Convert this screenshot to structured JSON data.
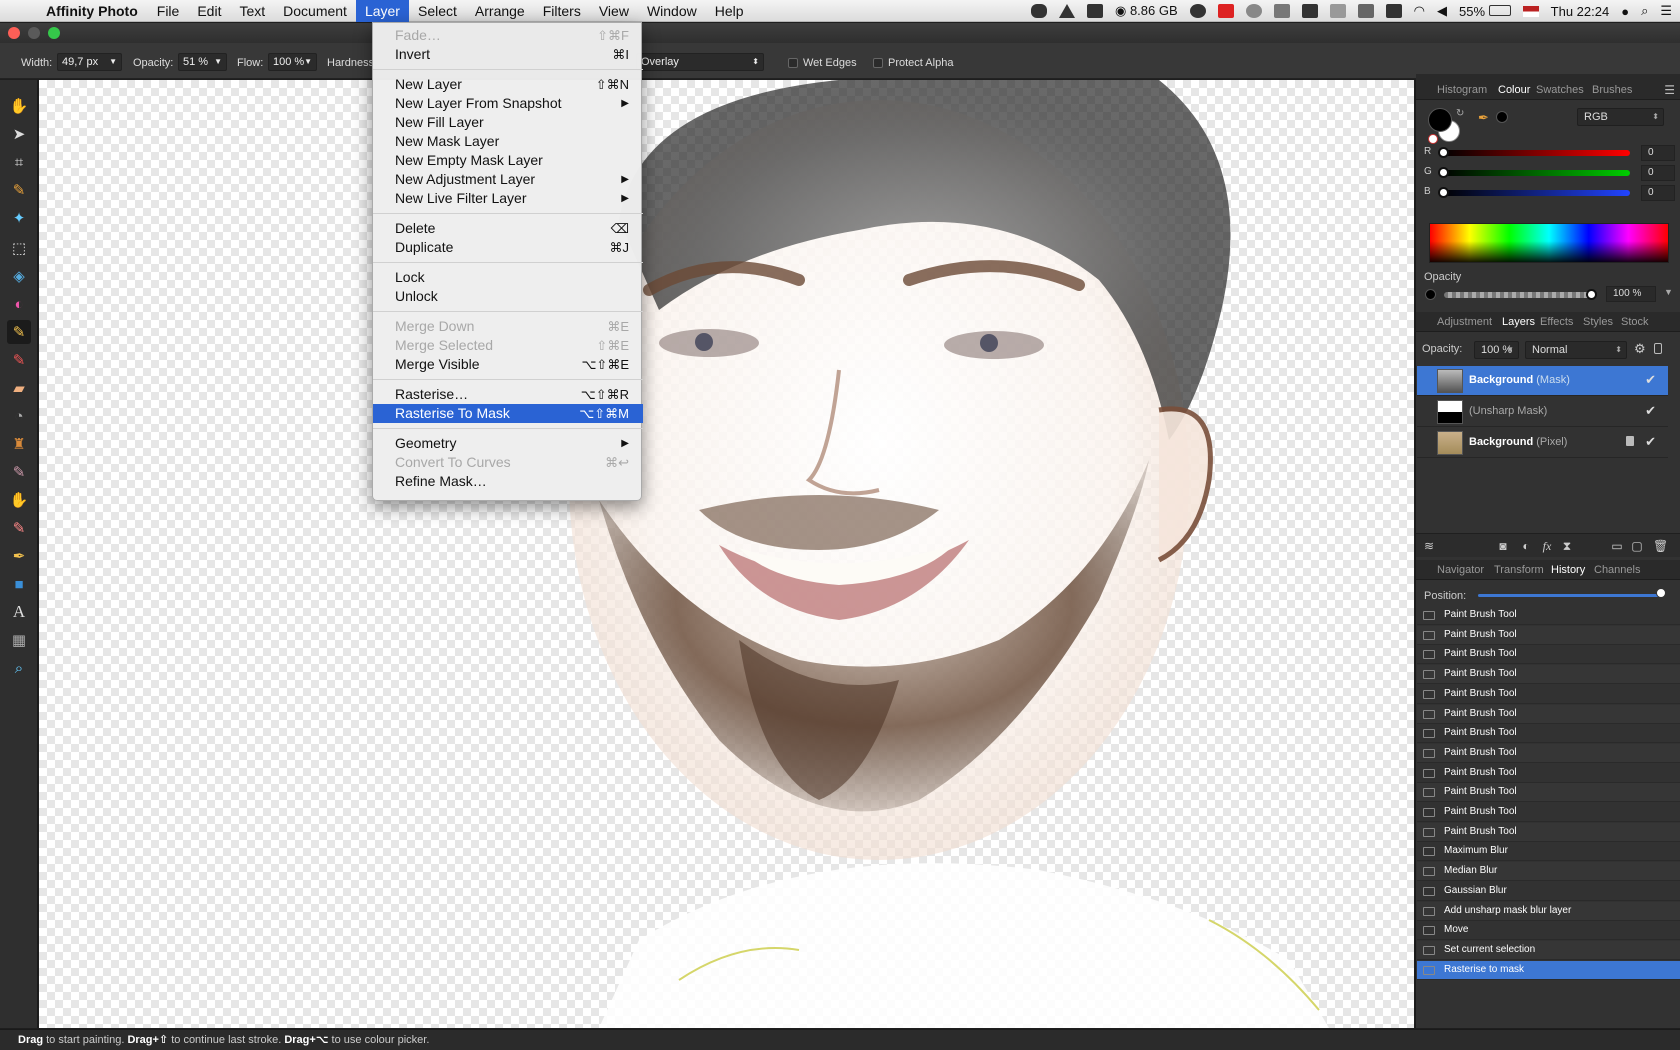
{
  "menubar": {
    "app_name": "Affinity Photo",
    "items": [
      "File",
      "Edit",
      "Text",
      "Document",
      "Layer",
      "Select",
      "Arrange",
      "Filters",
      "View",
      "Window",
      "Help"
    ],
    "memory": "8.86 GB",
    "battery": "55%",
    "clock": "Thu 22:24"
  },
  "context_toolbar": {
    "width_label": "Width:",
    "width_value": "49,7 px",
    "opacity_label": "Opacity:",
    "opacity_value": "51 %",
    "flow_label": "Flow:",
    "flow_value": "100 %",
    "hardness_label": "Hardness",
    "blend_mode": "Overlay",
    "wet_edges": "Wet Edges",
    "protect_alpha": "Protect Alpha"
  },
  "layer_menu": {
    "items": [
      {
        "label": "Fade…",
        "shortcut": "⇧⌘F",
        "disabled": true
      },
      {
        "label": "Invert",
        "shortcut": "⌘I"
      },
      {
        "sep": true
      },
      {
        "label": "New Layer",
        "shortcut": "⇧⌘N"
      },
      {
        "label": "New Layer From Snapshot",
        "submenu": true
      },
      {
        "label": "New Fill Layer"
      },
      {
        "label": "New Mask Layer"
      },
      {
        "label": "New Empty Mask Layer"
      },
      {
        "label": "New Adjustment Layer",
        "submenu": true
      },
      {
        "label": "New Live Filter Layer",
        "submenu": true
      },
      {
        "sep": true
      },
      {
        "label": "Delete",
        "shortcut": "⌫"
      },
      {
        "label": "Duplicate",
        "shortcut": "⌘J"
      },
      {
        "sep": true
      },
      {
        "label": "Lock"
      },
      {
        "label": "Unlock"
      },
      {
        "sep": true
      },
      {
        "label": "Merge Down",
        "shortcut": "⌘E",
        "disabled": true
      },
      {
        "label": "Merge Selected",
        "shortcut": "⇧⌘E",
        "disabled": true
      },
      {
        "label": "Merge Visible",
        "shortcut": "⌥⇧⌘E"
      },
      {
        "sep": true
      },
      {
        "label": "Rasterise…",
        "shortcut": "⌥⇧⌘R"
      },
      {
        "label": "Rasterise To Mask",
        "shortcut": "⌥⇧⌘M",
        "highlight": true
      },
      {
        "sep": true
      },
      {
        "label": "Geometry",
        "submenu": true
      },
      {
        "label": "Convert To Curves",
        "shortcut": "⌘↩",
        "disabled": true
      },
      {
        "label": "Refine Mask…"
      }
    ]
  },
  "colour_panel": {
    "tabs": [
      "Histogram",
      "Colour",
      "Swatches",
      "Brushes"
    ],
    "active_tab": "Colour",
    "model": "RGB",
    "channels": [
      {
        "label": "R",
        "value": "0"
      },
      {
        "label": "G",
        "value": "0"
      },
      {
        "label": "B",
        "value": "0"
      }
    ],
    "opacity_label": "Opacity",
    "opacity_value": "100 %"
  },
  "layers_panel": {
    "tabs": [
      "Adjustment",
      "Layers",
      "Effects",
      "Styles",
      "Stock"
    ],
    "active_tab": "Layers",
    "opacity_label": "Opacity:",
    "opacity_value": "100 %",
    "blend_mode": "Normal",
    "layers": [
      {
        "name": "Background",
        "type": "(Mask)",
        "selected": true
      },
      {
        "name": "",
        "type": "(Unsharp Mask)"
      },
      {
        "name": "Background",
        "type": "(Pixel)",
        "locked": true
      }
    ]
  },
  "history_panel": {
    "tabs": [
      "Navigator",
      "Transform",
      "History",
      "Channels"
    ],
    "active_tab": "History",
    "position_label": "Position:",
    "position_fraction": 1.0,
    "entries": [
      "Paint Brush Tool",
      "Paint Brush Tool",
      "Paint Brush Tool",
      "Paint Brush Tool",
      "Paint Brush Tool",
      "Paint Brush Tool",
      "Paint Brush Tool",
      "Paint Brush Tool",
      "Paint Brush Tool",
      "Paint Brush Tool",
      "Paint Brush Tool",
      "Paint Brush Tool",
      "Maximum Blur",
      "Median Blur",
      "Gaussian Blur",
      "Add unsharp mask blur layer",
      "Move",
      "Set current selection",
      "Rasterise to mask"
    ],
    "selected_index": 18
  },
  "statusbar": {
    "parts": [
      {
        "bold": "Drag",
        "text": " to start painting. "
      },
      {
        "bold": "Drag+⇧",
        "text": " to continue last stroke. "
      },
      {
        "bold": "Drag+⌥",
        "text": " to use colour picker."
      }
    ]
  },
  "colors": {
    "accent": "#3d77d3",
    "menu_highlight": "#2a63d4"
  }
}
